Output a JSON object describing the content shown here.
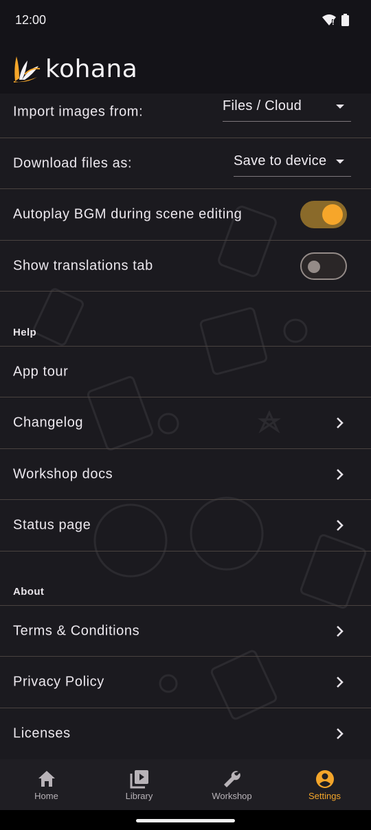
{
  "status_bar": {
    "time": "12:00",
    "wifi_icon": "wifi-icon",
    "battery_icon": "battery-icon"
  },
  "app": {
    "name": "kohana",
    "logo_icon": "kohana-flower-logo",
    "accent": "#F6A62A"
  },
  "settings": {
    "import_label": "Import images from:",
    "import_value": "Files / Cloud",
    "download_label": "Download files as:",
    "download_value": "Save to device",
    "autoplay_label": "Autoplay BGM during scene editing",
    "autoplay_on": true,
    "translations_label": "Show translations tab",
    "translations_on": false
  },
  "help": {
    "header": "Help",
    "items": [
      {
        "label": "App tour",
        "chevron": false
      },
      {
        "label": "Changelog",
        "chevron": true
      },
      {
        "label": "Workshop docs",
        "chevron": true
      },
      {
        "label": "Status page",
        "chevron": true
      }
    ]
  },
  "about": {
    "header": "About",
    "items": [
      {
        "label": "Terms & Conditions",
        "chevron": true
      },
      {
        "label": "Privacy Policy",
        "chevron": true
      },
      {
        "label": "Licenses",
        "chevron": true
      }
    ]
  },
  "nav": {
    "items": [
      {
        "label": "Home",
        "icon": "home-icon",
        "active": false
      },
      {
        "label": "Library",
        "icon": "library-icon",
        "active": false
      },
      {
        "label": "Workshop",
        "icon": "wrench-icon",
        "active": false
      },
      {
        "label": "Settings",
        "icon": "account-circle-icon",
        "active": true
      }
    ]
  }
}
